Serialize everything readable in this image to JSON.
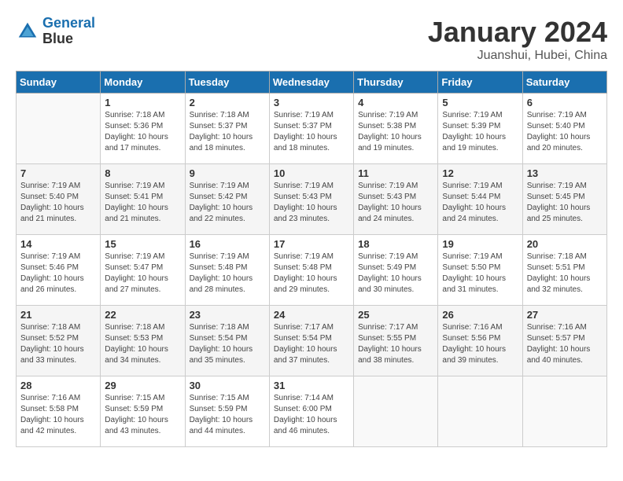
{
  "header": {
    "logo_line1": "General",
    "logo_line2": "Blue",
    "month": "January 2024",
    "location": "Juanshui, Hubei, China"
  },
  "days_of_week": [
    "Sunday",
    "Monday",
    "Tuesday",
    "Wednesday",
    "Thursday",
    "Friday",
    "Saturday"
  ],
  "weeks": [
    [
      {
        "day": "",
        "sunrise": "",
        "sunset": "",
        "daylight": ""
      },
      {
        "day": "1",
        "sunrise": "Sunrise: 7:18 AM",
        "sunset": "Sunset: 5:36 PM",
        "daylight": "Daylight: 10 hours and 17 minutes."
      },
      {
        "day": "2",
        "sunrise": "Sunrise: 7:18 AM",
        "sunset": "Sunset: 5:37 PM",
        "daylight": "Daylight: 10 hours and 18 minutes."
      },
      {
        "day": "3",
        "sunrise": "Sunrise: 7:19 AM",
        "sunset": "Sunset: 5:37 PM",
        "daylight": "Daylight: 10 hours and 18 minutes."
      },
      {
        "day": "4",
        "sunrise": "Sunrise: 7:19 AM",
        "sunset": "Sunset: 5:38 PM",
        "daylight": "Daylight: 10 hours and 19 minutes."
      },
      {
        "day": "5",
        "sunrise": "Sunrise: 7:19 AM",
        "sunset": "Sunset: 5:39 PM",
        "daylight": "Daylight: 10 hours and 19 minutes."
      },
      {
        "day": "6",
        "sunrise": "Sunrise: 7:19 AM",
        "sunset": "Sunset: 5:40 PM",
        "daylight": "Daylight: 10 hours and 20 minutes."
      }
    ],
    [
      {
        "day": "7",
        "sunrise": "Sunrise: 7:19 AM",
        "sunset": "Sunset: 5:40 PM",
        "daylight": "Daylight: 10 hours and 21 minutes."
      },
      {
        "day": "8",
        "sunrise": "Sunrise: 7:19 AM",
        "sunset": "Sunset: 5:41 PM",
        "daylight": "Daylight: 10 hours and 21 minutes."
      },
      {
        "day": "9",
        "sunrise": "Sunrise: 7:19 AM",
        "sunset": "Sunset: 5:42 PM",
        "daylight": "Daylight: 10 hours and 22 minutes."
      },
      {
        "day": "10",
        "sunrise": "Sunrise: 7:19 AM",
        "sunset": "Sunset: 5:43 PM",
        "daylight": "Daylight: 10 hours and 23 minutes."
      },
      {
        "day": "11",
        "sunrise": "Sunrise: 7:19 AM",
        "sunset": "Sunset: 5:43 PM",
        "daylight": "Daylight: 10 hours and 24 minutes."
      },
      {
        "day": "12",
        "sunrise": "Sunrise: 7:19 AM",
        "sunset": "Sunset: 5:44 PM",
        "daylight": "Daylight: 10 hours and 24 minutes."
      },
      {
        "day": "13",
        "sunrise": "Sunrise: 7:19 AM",
        "sunset": "Sunset: 5:45 PM",
        "daylight": "Daylight: 10 hours and 25 minutes."
      }
    ],
    [
      {
        "day": "14",
        "sunrise": "Sunrise: 7:19 AM",
        "sunset": "Sunset: 5:46 PM",
        "daylight": "Daylight: 10 hours and 26 minutes."
      },
      {
        "day": "15",
        "sunrise": "Sunrise: 7:19 AM",
        "sunset": "Sunset: 5:47 PM",
        "daylight": "Daylight: 10 hours and 27 minutes."
      },
      {
        "day": "16",
        "sunrise": "Sunrise: 7:19 AM",
        "sunset": "Sunset: 5:48 PM",
        "daylight": "Daylight: 10 hours and 28 minutes."
      },
      {
        "day": "17",
        "sunrise": "Sunrise: 7:19 AM",
        "sunset": "Sunset: 5:48 PM",
        "daylight": "Daylight: 10 hours and 29 minutes."
      },
      {
        "day": "18",
        "sunrise": "Sunrise: 7:19 AM",
        "sunset": "Sunset: 5:49 PM",
        "daylight": "Daylight: 10 hours and 30 minutes."
      },
      {
        "day": "19",
        "sunrise": "Sunrise: 7:19 AM",
        "sunset": "Sunset: 5:50 PM",
        "daylight": "Daylight: 10 hours and 31 minutes."
      },
      {
        "day": "20",
        "sunrise": "Sunrise: 7:18 AM",
        "sunset": "Sunset: 5:51 PM",
        "daylight": "Daylight: 10 hours and 32 minutes."
      }
    ],
    [
      {
        "day": "21",
        "sunrise": "Sunrise: 7:18 AM",
        "sunset": "Sunset: 5:52 PM",
        "daylight": "Daylight: 10 hours and 33 minutes."
      },
      {
        "day": "22",
        "sunrise": "Sunrise: 7:18 AM",
        "sunset": "Sunset: 5:53 PM",
        "daylight": "Daylight: 10 hours and 34 minutes."
      },
      {
        "day": "23",
        "sunrise": "Sunrise: 7:18 AM",
        "sunset": "Sunset: 5:54 PM",
        "daylight": "Daylight: 10 hours and 35 minutes."
      },
      {
        "day": "24",
        "sunrise": "Sunrise: 7:17 AM",
        "sunset": "Sunset: 5:54 PM",
        "daylight": "Daylight: 10 hours and 37 minutes."
      },
      {
        "day": "25",
        "sunrise": "Sunrise: 7:17 AM",
        "sunset": "Sunset: 5:55 PM",
        "daylight": "Daylight: 10 hours and 38 minutes."
      },
      {
        "day": "26",
        "sunrise": "Sunrise: 7:16 AM",
        "sunset": "Sunset: 5:56 PM",
        "daylight": "Daylight: 10 hours and 39 minutes."
      },
      {
        "day": "27",
        "sunrise": "Sunrise: 7:16 AM",
        "sunset": "Sunset: 5:57 PM",
        "daylight": "Daylight: 10 hours and 40 minutes."
      }
    ],
    [
      {
        "day": "28",
        "sunrise": "Sunrise: 7:16 AM",
        "sunset": "Sunset: 5:58 PM",
        "daylight": "Daylight: 10 hours and 42 minutes."
      },
      {
        "day": "29",
        "sunrise": "Sunrise: 7:15 AM",
        "sunset": "Sunset: 5:59 PM",
        "daylight": "Daylight: 10 hours and 43 minutes."
      },
      {
        "day": "30",
        "sunrise": "Sunrise: 7:15 AM",
        "sunset": "Sunset: 5:59 PM",
        "daylight": "Daylight: 10 hours and 44 minutes."
      },
      {
        "day": "31",
        "sunrise": "Sunrise: 7:14 AM",
        "sunset": "Sunset: 6:00 PM",
        "daylight": "Daylight: 10 hours and 46 minutes."
      },
      {
        "day": "",
        "sunrise": "",
        "sunset": "",
        "daylight": ""
      },
      {
        "day": "",
        "sunrise": "",
        "sunset": "",
        "daylight": ""
      },
      {
        "day": "",
        "sunrise": "",
        "sunset": "",
        "daylight": ""
      }
    ]
  ]
}
